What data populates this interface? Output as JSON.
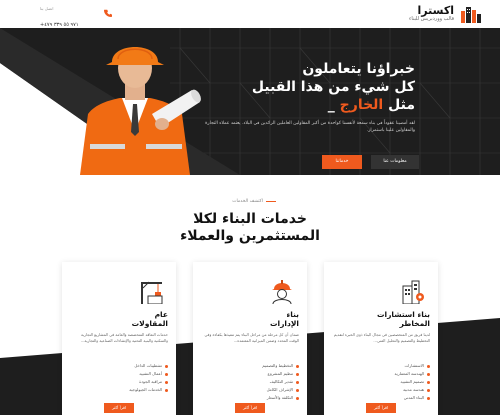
{
  "header": {
    "logo_title": "اكسترا",
    "logo_subtitle": "قالب ووردبريس للبناء",
    "phone_label": "اتصل بنا",
    "phone_number": "+٩٧١ ٥٥ ٣٣٩ ٤٧٩",
    "accent": "#ef5a1e"
  },
  "hero": {
    "line1": "خبراؤنا يتعاملون",
    "line2": "كل شيء من هذا القبيل",
    "line3_prefix": "مثل ",
    "line3_highlight": "الخارج",
    "line3_suffix": " _",
    "description": "لقد أمضينا عقوداً في بناء سمعة لأنفسنا كواحدة من أكبر المقاولين العاملين الرائدين في البلاد. يعتمد عملاء التجارة والمقاولين علينا باستمرار.",
    "btn_more": "معلومات عنا",
    "btn_contact": "خدماتنا"
  },
  "services": {
    "eyebrow": "اكتشف الخدمات",
    "title_line1": "خدمات البناء لكلا",
    "title_line2": "المستثمرين والعملاء",
    "cards": [
      {
        "icon": "building-crane-icon",
        "title_line1": "عام",
        "title_line2": "المقاولات",
        "description": "خدمات التعاقد المتخصصة والعامة في المشاريع التجارية والسكنية والبنية التحتية والإنشاءات الصناعية والتجارية...",
        "items": [
          "تشطيبات الداخل",
          "أعمال التشييد",
          "مراقبة الجودة",
          "الخدمات الجيولوجية"
        ],
        "button": "اقرأ أكثر"
      },
      {
        "icon": "worker-helmet-icon",
        "title_line1": "بناء",
        "title_line2": "الإدارات",
        "description": "ضمان أن كل مرحلة من مراحل البناء يتم تنفيذها بكفاءة وفي الوقت المحدد وضمن الميزانية المعتمدة...",
        "items": [
          "التخطيط والتصميم",
          "تنظيم المشروع",
          "تقدير التكاليف",
          "الإشراف الكامل",
          "التكلفة والأسعار"
        ],
        "button": "اقرأ أكثر"
      },
      {
        "icon": "building-gear-icon",
        "title_line1": "بناء استشارات",
        "title_line2": "المخاطر",
        "description": "لدينا فريق من المتخصصين في مجال البناء ذوي الخبرة لتقديم التخطيط والتصميم والتحليل الفني...",
        "items": [
          "الاستشارات",
          "الهندسة المعمارية",
          "تصميم التشييد",
          "هندسة مدنية",
          "البناء المدني"
        ],
        "button": "اقرأ أكثر"
      }
    ]
  }
}
